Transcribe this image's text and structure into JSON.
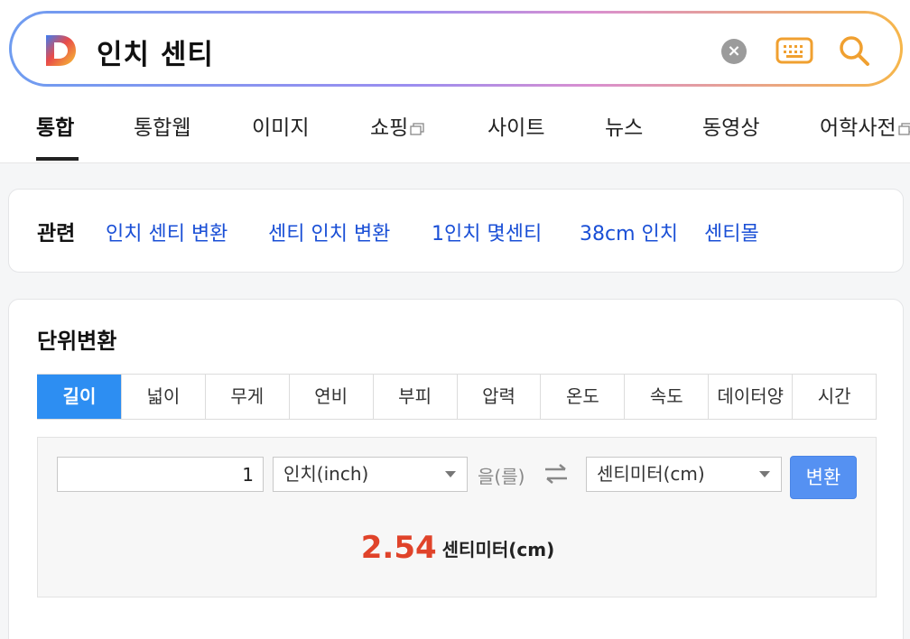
{
  "search": {
    "query": "인치 센티",
    "logo_letter": "D"
  },
  "tabs": [
    {
      "label": "통합",
      "active": true
    },
    {
      "label": "통합웹"
    },
    {
      "label": "이미지"
    },
    {
      "label": "쇼핑"
    },
    {
      "label": "사이트"
    },
    {
      "label": "뉴스"
    },
    {
      "label": "동영상"
    },
    {
      "label": "어학사전"
    }
  ],
  "related": {
    "title": "관련",
    "links": [
      "인치 센티 변환",
      "센티 인치 변환",
      "1인치 몇센티",
      "38cm 인치",
      "센티몰"
    ]
  },
  "unit_converter": {
    "title": "단위변환",
    "tabs": [
      "길이",
      "넓이",
      "무게",
      "연비",
      "부피",
      "압력",
      "온도",
      "속도",
      "데이터양",
      "시간"
    ],
    "active_tab": "길이",
    "input_value": "1",
    "from_unit": "인치(inch)",
    "particle": "을(를)",
    "to_unit": "센티미터(cm)",
    "convert_label": "변환",
    "result_value": "2.54",
    "result_unit": "센티미터(cm)"
  },
  "colors": {
    "accent_blue": "#2d8ef2",
    "link_blue": "#1a4fd6",
    "result_red": "#e0432a",
    "keyboard_orange": "#f0a030"
  },
  "icons": [
    "daum-logo-icon",
    "clear-icon",
    "keyboard-icon",
    "search-icon",
    "external-window-icon",
    "swap-arrows-icon",
    "dropdown-arrow-icon"
  ]
}
